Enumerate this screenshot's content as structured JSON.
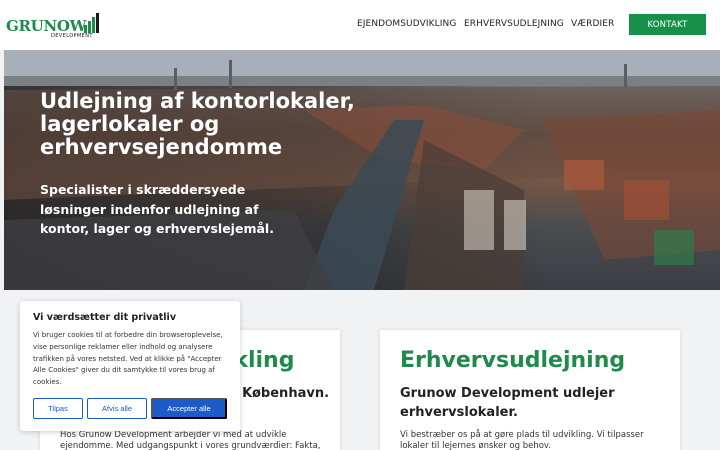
{
  "brand": {
    "name": "GRUNOW",
    "sub": "DEVELOPMENT",
    "accent": "#1f8a4c"
  },
  "nav": {
    "items": [
      "EJENDOMSUDVIKLING",
      "ERHVERVSUDLEJNING",
      "VÆRDIER"
    ],
    "cta": "KONTAKT"
  },
  "hero": {
    "title": "Udlejning af kontorlokaler, lagerlokaler og erhvervsejendomme",
    "subtitle": "Specialister i skræddersyede løsninger indenfor udlejning af kontor, lager og erhvervslejemål."
  },
  "cards": [
    {
      "heading": "Ejendomsudvikling",
      "lead": "Vi udvikler ejendomme i København.",
      "text": "Hos Grunow Development arbejder vi med at udvikle ejendomme. Med udgangspunkt i vores grundværdier: Fakta,"
    },
    {
      "heading": "Erhvervsudlejning",
      "lead": "Grunow Development udlejer erhvervslokaler.",
      "text": "Vi bestræber os på at gøre plads til udvikling. Vi tilpasser lokaler til lejernes ønsker og behov."
    }
  ],
  "cookie": {
    "title": "Vi værdsætter dit privatliv",
    "body": "Vi bruger cookies til at forbedre din browseroplevelse, vise personlige reklamer eller indhold og analysere trafikken på vores netsted. Ved at klikke på \"Accepter Alle Cookies\" giver du dit samtykke til vores brug af cookies.",
    "buttons": {
      "customize": "Tilpas",
      "reject": "Afvis alle",
      "accept": "Accepter alle"
    },
    "button_color": "#1c5bc9"
  }
}
